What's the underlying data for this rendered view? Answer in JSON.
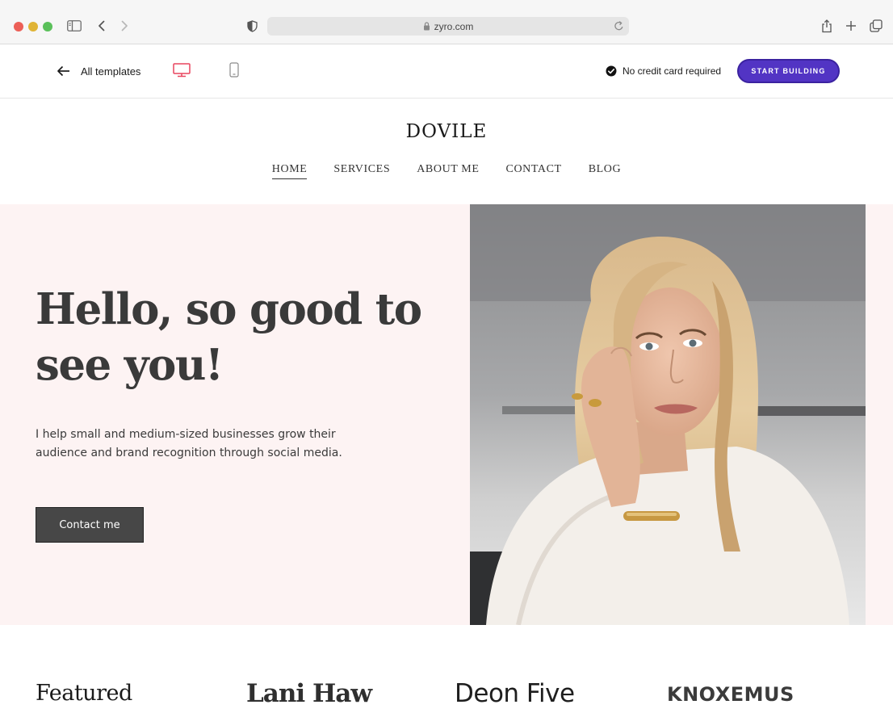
{
  "browser": {
    "url": "zyro.com"
  },
  "toolbar": {
    "back_label": "All templates",
    "credit_note": "No credit card required",
    "start_button": "START BUILDING",
    "accent": "#5234c4",
    "active_device_color": "#e8455f"
  },
  "site": {
    "logo": "DOVILE",
    "nav": [
      {
        "label": "HOME",
        "active": true
      },
      {
        "label": "SERVICES",
        "active": false
      },
      {
        "label": "ABOUT ME",
        "active": false
      },
      {
        "label": "CONTACT",
        "active": false
      },
      {
        "label": "BLOG",
        "active": false
      }
    ]
  },
  "hero": {
    "title": "Hello, so good to see you!",
    "text": "I help small and medium-sized businesses grow their audience and brand recognition through social media.",
    "button": "Contact me",
    "background": "#fdf3f3"
  },
  "featured": {
    "label": "Featured",
    "logos": [
      "Lani Haw",
      "Deon Five",
      "KNOXEMUS"
    ]
  }
}
